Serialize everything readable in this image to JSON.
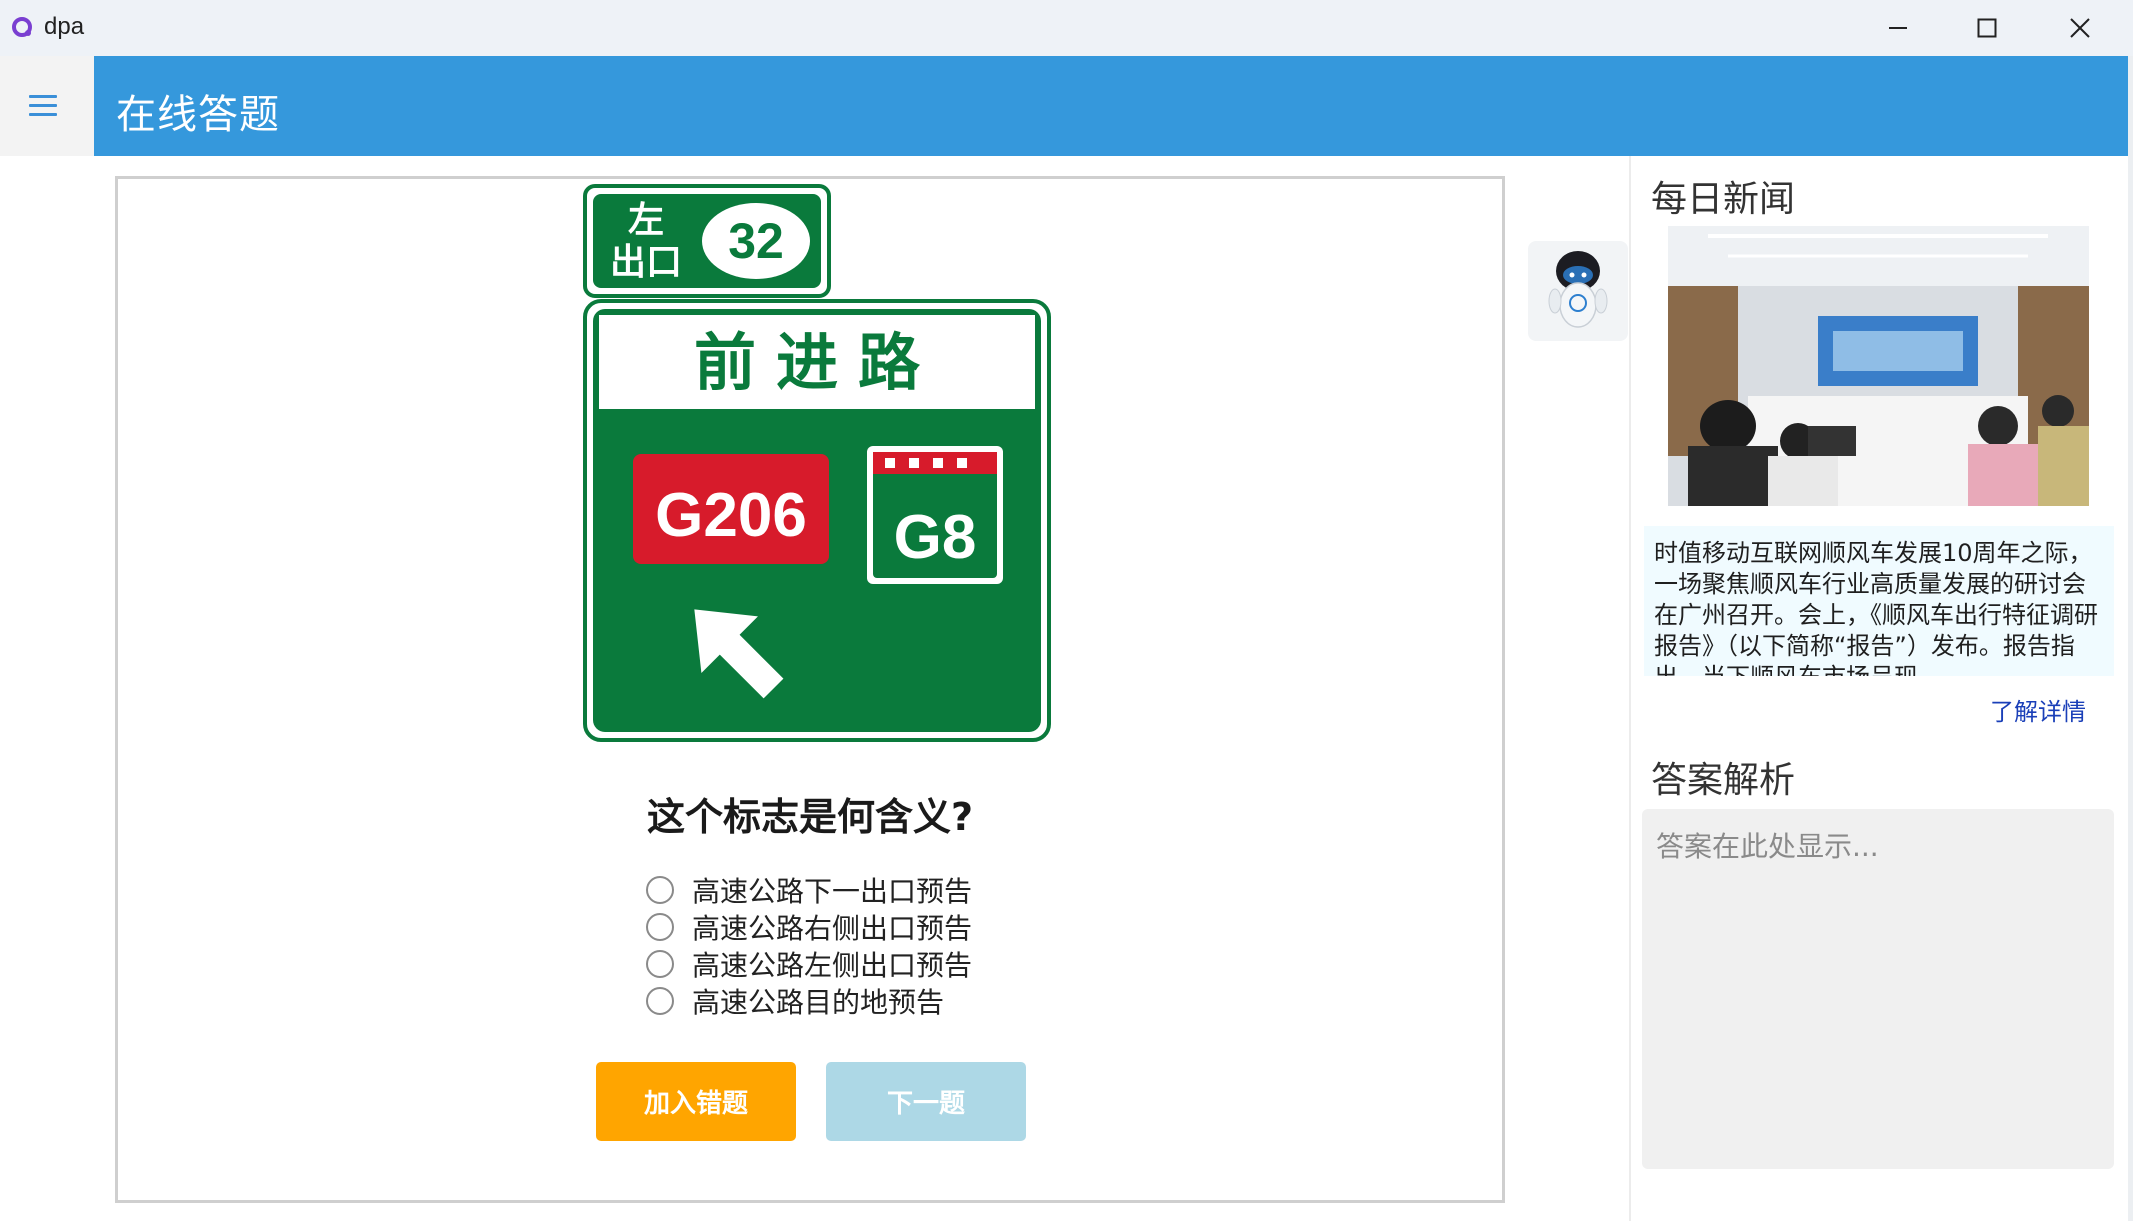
{
  "window": {
    "title": "dpa",
    "icon": "app-logo-icon",
    "controls": [
      "minimize-icon",
      "maximize-icon",
      "close-icon"
    ]
  },
  "header": {
    "menu_icon": "hamburger-menu-icon",
    "title": "在线答题",
    "color": "#3598dc"
  },
  "quiz": {
    "sign": {
      "exit_side": "左出口",
      "exit_side_line1": "左",
      "exit_side_line2": "出口",
      "exit_number": "32",
      "road_name": "前进路",
      "route_national": "G206",
      "route_expressway": "G8",
      "arrow": "up-left-arrow-icon"
    },
    "question": "这个标志是何含义?",
    "options": [
      "高速公路下一出口预告",
      "高速公路右侧出口预告",
      "高速公路左侧出口预告",
      "高速公路目的地预告"
    ],
    "selected": null,
    "add_wrong_label": "加入错题",
    "next_label": "下一题"
  },
  "assistant": {
    "icon": "robot-assistant-icon"
  },
  "news": {
    "title": "每日新闻",
    "photo": "news-photo-meeting",
    "text": "时值移动互联网顺风车发展10周年之际，一场聚焦顺风车行业高质量发展的研讨会在广州召开。会上，《顺风车出行特征调研报告》（以下简称“报告”）发布。报告指出，当下顺风车市场呈现……",
    "more_label": "了解详情"
  },
  "analysis": {
    "title": "答案解析",
    "placeholder": "答案在此处显示..."
  }
}
